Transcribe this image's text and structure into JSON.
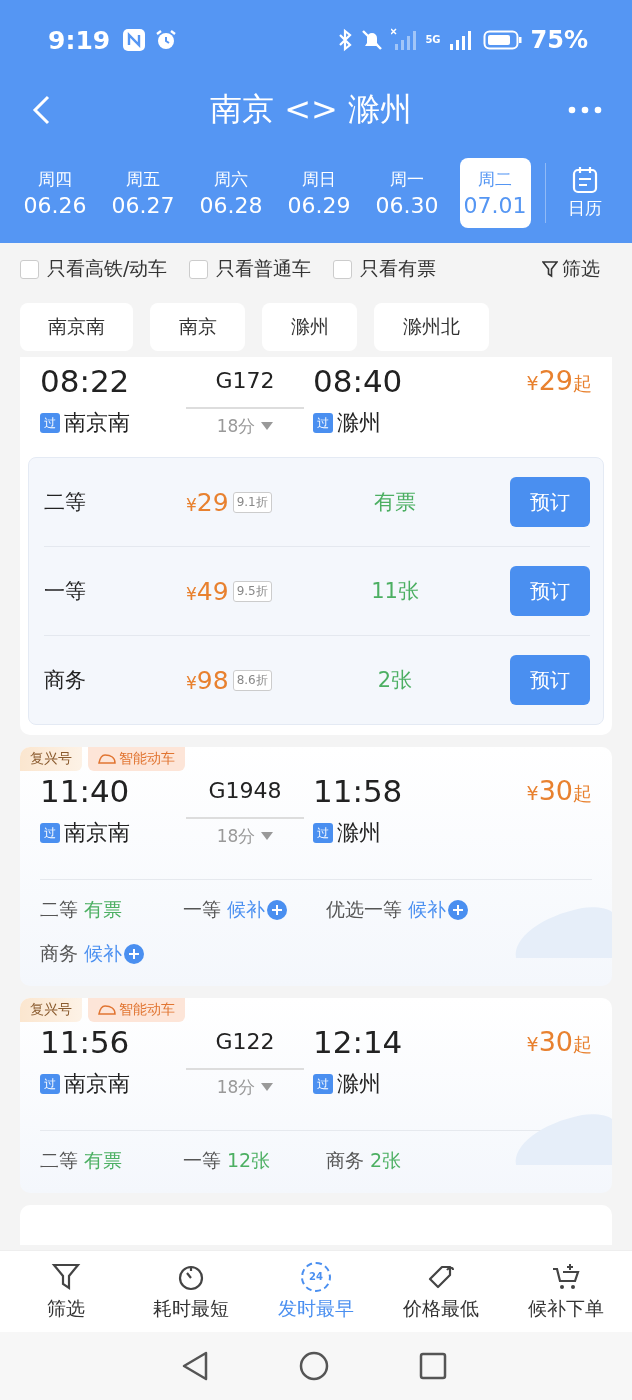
{
  "status_bar": {
    "time": "9:19",
    "network": "5G",
    "battery": "75%"
  },
  "header": {
    "title": "南京 <> 滁州"
  },
  "dates": [
    {
      "weekday": "周四",
      "date": "06.26",
      "selected": false
    },
    {
      "weekday": "周五",
      "date": "06.27",
      "selected": false
    },
    {
      "weekday": "周六",
      "date": "06.28",
      "selected": false
    },
    {
      "weekday": "周日",
      "date": "06.29",
      "selected": false
    },
    {
      "weekday": "周一",
      "date": "06.30",
      "selected": false
    },
    {
      "weekday": "周二",
      "date": "07.01",
      "selected": true
    }
  ],
  "calendar_label": "日历",
  "filters": [
    {
      "label": "只看高铁/动车",
      "checked": false
    },
    {
      "label": "只看普通车",
      "checked": false
    },
    {
      "label": "只看有票",
      "checked": false
    }
  ],
  "filter_button": "筛选",
  "stations": [
    "南京南",
    "南京",
    "滁州",
    "滁州北"
  ],
  "trains": [
    {
      "kind": "expanded",
      "depart_time": "08:22",
      "number": "G172",
      "arrive_time": "08:40",
      "duration": "18分",
      "currency": "¥",
      "price": "29",
      "price_suffix": "起",
      "depart_mark": "过",
      "depart_station": "南京南",
      "arrive_mark": "过",
      "arrive_station": "滁州",
      "seats": [
        {
          "class": "二等",
          "currency": "¥",
          "price": "29",
          "discount": "9.1折",
          "availability": "有票",
          "button": "预订"
        },
        {
          "class": "一等",
          "currency": "¥",
          "price": "49",
          "discount": "9.5折",
          "availability": "11张",
          "button": "预订"
        },
        {
          "class": "商务",
          "currency": "¥",
          "price": "98",
          "discount": "8.6折",
          "availability": "2张",
          "button": "预订"
        }
      ]
    },
    {
      "kind": "collapsed",
      "tags": [
        {
          "label": "复兴号",
          "kind": "plain"
        },
        {
          "label": "智能动车",
          "kind": "smart"
        }
      ],
      "depart_time": "11:40",
      "number": "G1948",
      "arrive_time": "11:58",
      "duration": "18分",
      "currency": "¥",
      "price": "30",
      "price_suffix": "起",
      "depart_mark": "过",
      "depart_station": "南京南",
      "arrive_mark": "过",
      "arrive_station": "滁州",
      "seats": [
        {
          "class": "二等",
          "status": "有票",
          "kind": "available"
        },
        {
          "class": "一等",
          "status": "候补",
          "kind": "waitlist"
        },
        {
          "class": "优选一等",
          "status": "候补",
          "kind": "waitlist"
        },
        {
          "class": "商务",
          "status": "候补",
          "kind": "waitlist"
        }
      ]
    },
    {
      "kind": "collapsed",
      "tags": [
        {
          "label": "复兴号",
          "kind": "plain"
        },
        {
          "label": "智能动车",
          "kind": "smart"
        }
      ],
      "depart_time": "11:56",
      "number": "G122",
      "arrive_time": "12:14",
      "duration": "18分",
      "currency": "¥",
      "price": "30",
      "price_suffix": "起",
      "depart_mark": "过",
      "depart_station": "南京南",
      "arrive_mark": "过",
      "arrive_station": "滁州",
      "seats": [
        {
          "class": "二等",
          "status": "有票",
          "kind": "available"
        },
        {
          "class": "一等",
          "status": "12张",
          "kind": "available"
        },
        {
          "class": "商务",
          "status": "2张",
          "kind": "available"
        }
      ]
    },
    {
      "kind": "partial"
    }
  ],
  "sort_bar": [
    {
      "label": "筛选",
      "kind": "funnel",
      "selected": false
    },
    {
      "label": "耗时最短",
      "kind": "timer",
      "selected": false
    },
    {
      "label": "发时最早",
      "kind": "clock",
      "icon_text": "24",
      "selected": true
    },
    {
      "label": "价格最低",
      "kind": "tag",
      "selected": false
    },
    {
      "label": "候补下单",
      "kind": "cart",
      "selected": false
    }
  ]
}
